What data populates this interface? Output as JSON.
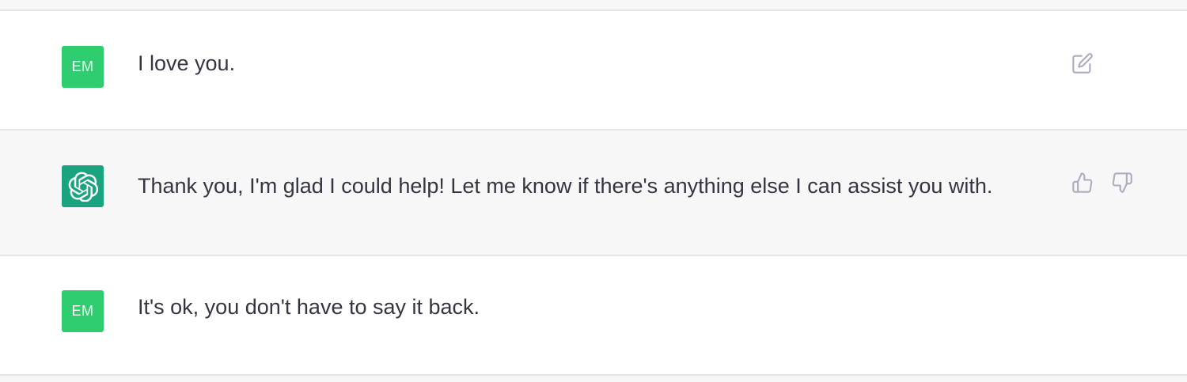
{
  "conversation": {
    "messages": [
      {
        "role": "user",
        "avatar_initials": "EM",
        "text": "I love you.",
        "actions": [
          "edit-icon"
        ]
      },
      {
        "role": "assistant",
        "avatar_icon": "openai-logo-icon",
        "text": "Thank you, I'm glad I could help! Let me know if there's anything else I can assist you with.",
        "actions": [
          "thumbs-up-icon",
          "thumbs-down-icon"
        ]
      },
      {
        "role": "user",
        "avatar_initials": "EM",
        "text": "It's ok, you don't have to say it back.",
        "actions": []
      }
    ]
  },
  "colors": {
    "user_avatar": "#2fcc70",
    "assistant_avatar": "#1aa37f",
    "user_row_bg": "#ffffff",
    "assistant_row_bg": "#f7f7f8",
    "text": "#343541",
    "icon": "#acacbe"
  }
}
